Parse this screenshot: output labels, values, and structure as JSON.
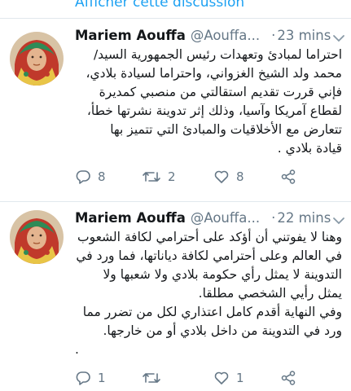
{
  "top_link": "Afficher cette discussion",
  "tweets": [
    {
      "name": "Mariem Aouffa",
      "handle": "@Aouffa...",
      "separator": "·",
      "time": "23 mins",
      "lines": [
        "احتراما لمبادئ وتعهدات رئيس الجمهورية السيد/",
        "محمد ولد الشيخ الغزواني، واحتراما لسيادة بلادي،",
        "فإني قررت تقديم استقالتي من منصبي كمديرة",
        "لقطاع آمريكا وآسيا، وذلك إثر تدوينة نشرتها خطأ،",
        "تتعارض مع الأخلاقيات والمبادئ التي تتميز بها",
        "قيادة بلادي ."
      ],
      "replies": "8",
      "retweets": "2",
      "likes": "8"
    },
    {
      "name": "Mariem Aouffa",
      "handle": "@Aouffa...",
      "separator": "·",
      "time": "22 mins",
      "lines": [
        "وهنا لا يفوتني أن أؤكد على أحترامي لكافة الشعوب",
        "في العالم وعلى أحترامي لكافة دياناتها، فما ورد في",
        "التدوينة لا يمثل رأي حكومة بلادي ولا شعبها ولا",
        "يمثل رأيي الشخصي مطلقا.",
        "وفي النهاية أقدم كامل اعتذاري لكل من تضرر مما",
        "ورد في التدوينة من داخل بلادي أو من خارجها.",
        "."
      ],
      "replies": "1",
      "retweets": "",
      "likes": "1"
    }
  ],
  "colors": {
    "link": "#1da1f2",
    "secondary": "#657786",
    "text": "#14171a",
    "divider": "#e1e8ed"
  },
  "icons": [
    "avatar",
    "chevron-down-icon",
    "reply-icon",
    "retweet-icon",
    "like-icon",
    "share-icon"
  ]
}
